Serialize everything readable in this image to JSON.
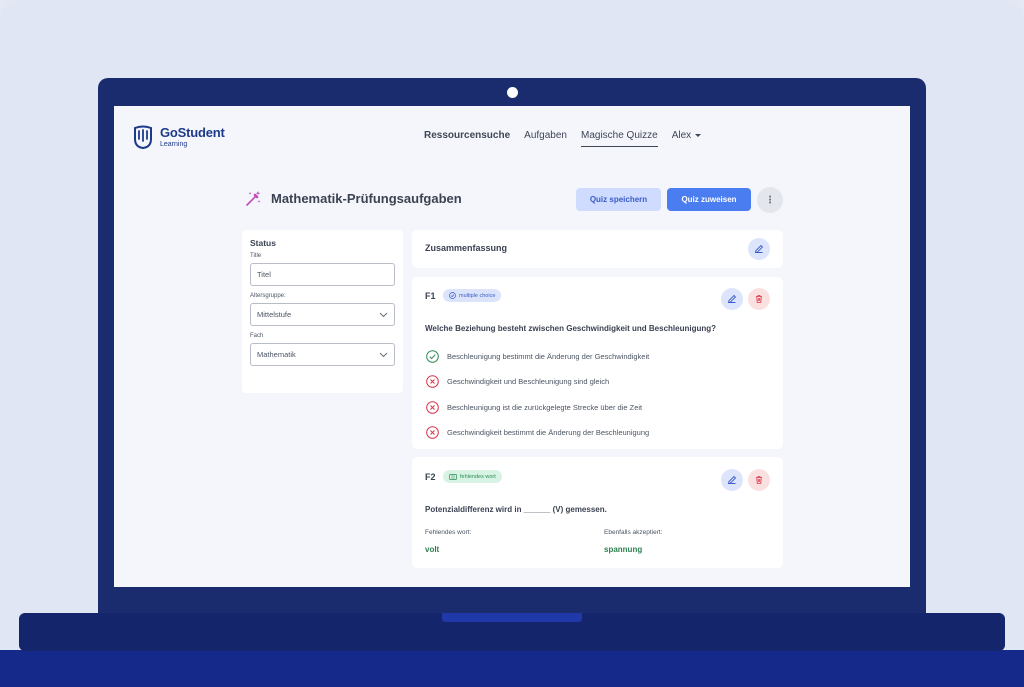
{
  "brand": {
    "name": "GoStudent",
    "sub": "Learning"
  },
  "nav": {
    "items": [
      "Ressourcensuche",
      "Aufgaben",
      "Magische Quizze"
    ],
    "user": "Alex"
  },
  "page": {
    "title": "Mathematik-Prüfungsaufgaben",
    "save_label": "Quiz speichern",
    "assign_label": "Quiz zuweisen",
    "more_label": "⋮"
  },
  "side": {
    "heading": "Status",
    "title_label": "Title",
    "title_placeholder": "Titel",
    "age_label": "Altersgruppe:",
    "age_value": "Mittelstufe",
    "subject_label": "Fach",
    "subject_value": "Mathematik"
  },
  "summary": {
    "title": "Zusammenfassung"
  },
  "questions": [
    {
      "number": "F1",
      "badge": "multiple choice",
      "text": "Welche Beziehung besteht zwischen Geschwindigkeit und Beschleunigung?",
      "answers": [
        {
          "text": "Beschleunigung bestimmt die Änderung der Geschwindigkeit",
          "correct": true
        },
        {
          "text": "Geschwindigkeit und Beschleunigung sind gleich",
          "correct": false
        },
        {
          "text": "Beschleunigung ist die zurückgelegte Strecke über die Zeit",
          "correct": false
        },
        {
          "text": "Geschwindigkeit bestimmt die Änderung der Beschleunigung",
          "correct": false
        }
      ]
    },
    {
      "number": "F2",
      "badge": "fehlendes wort",
      "text": "Potenzialdifferenz wird in ______ (V) gemessen.",
      "missing_label": "Fehlendes wort:",
      "missing_value": "volt",
      "accepted_label": "Ebenfalls akzeptiert:",
      "accepted_value": "spannung"
    }
  ],
  "colors": {
    "primary": "#4a7df0",
    "correct": "#2e8b57",
    "wrong": "#d9344a",
    "brand": "#1d3a8a",
    "device": "#1a2c6e"
  }
}
